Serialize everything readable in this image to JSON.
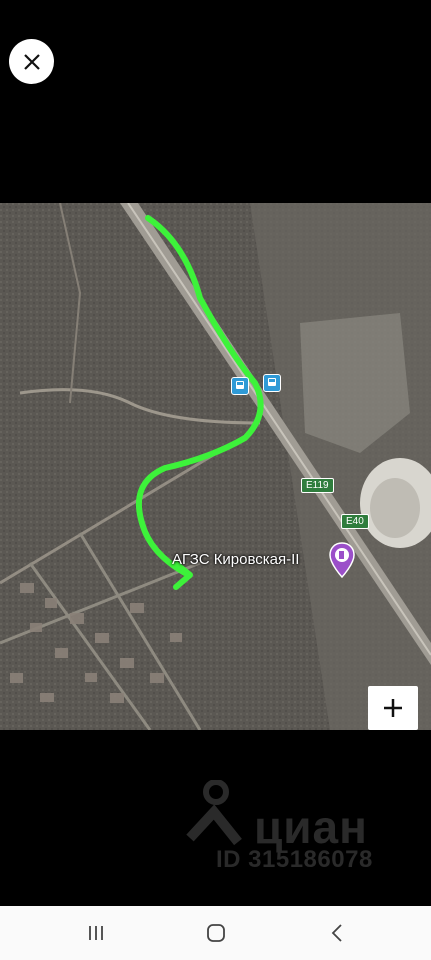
{
  "map": {
    "poi_label": "АГЗС Кировская-II",
    "road_badges": [
      "E119",
      "E40"
    ],
    "colors": {
      "route": "#3df23a",
      "bus": "#2f9ad6",
      "road_badge": "#2f7d3d",
      "fuel_pin": "#9b4fc9"
    }
  },
  "watermark": {
    "brand": "циан",
    "id_text": "ID 315186078"
  },
  "icons": {
    "close": "close-icon",
    "map_control": "plus-icon",
    "recents": "recents-icon",
    "home": "home-icon",
    "back": "back-icon"
  }
}
